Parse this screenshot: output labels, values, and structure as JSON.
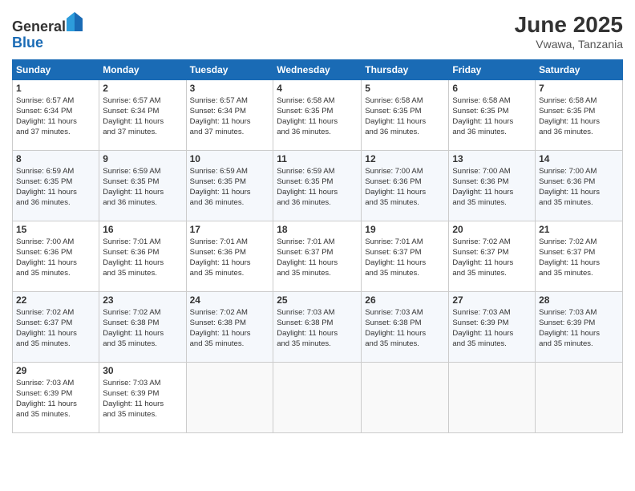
{
  "header": {
    "logo_general": "General",
    "logo_blue": "Blue",
    "month": "June 2025",
    "location": "Vwawa, Tanzania"
  },
  "days_of_week": [
    "Sunday",
    "Monday",
    "Tuesday",
    "Wednesday",
    "Thursday",
    "Friday",
    "Saturday"
  ],
  "weeks": [
    [
      {
        "day": "1",
        "info": "Sunrise: 6:57 AM\nSunset: 6:34 PM\nDaylight: 11 hours\nand 37 minutes."
      },
      {
        "day": "2",
        "info": "Sunrise: 6:57 AM\nSunset: 6:34 PM\nDaylight: 11 hours\nand 37 minutes."
      },
      {
        "day": "3",
        "info": "Sunrise: 6:57 AM\nSunset: 6:34 PM\nDaylight: 11 hours\nand 37 minutes."
      },
      {
        "day": "4",
        "info": "Sunrise: 6:58 AM\nSunset: 6:35 PM\nDaylight: 11 hours\nand 36 minutes."
      },
      {
        "day": "5",
        "info": "Sunrise: 6:58 AM\nSunset: 6:35 PM\nDaylight: 11 hours\nand 36 minutes."
      },
      {
        "day": "6",
        "info": "Sunrise: 6:58 AM\nSunset: 6:35 PM\nDaylight: 11 hours\nand 36 minutes."
      },
      {
        "day": "7",
        "info": "Sunrise: 6:58 AM\nSunset: 6:35 PM\nDaylight: 11 hours\nand 36 minutes."
      }
    ],
    [
      {
        "day": "8",
        "info": "Sunrise: 6:59 AM\nSunset: 6:35 PM\nDaylight: 11 hours\nand 36 minutes."
      },
      {
        "day": "9",
        "info": "Sunrise: 6:59 AM\nSunset: 6:35 PM\nDaylight: 11 hours\nand 36 minutes."
      },
      {
        "day": "10",
        "info": "Sunrise: 6:59 AM\nSunset: 6:35 PM\nDaylight: 11 hours\nand 36 minutes."
      },
      {
        "day": "11",
        "info": "Sunrise: 6:59 AM\nSunset: 6:35 PM\nDaylight: 11 hours\nand 36 minutes."
      },
      {
        "day": "12",
        "info": "Sunrise: 7:00 AM\nSunset: 6:36 PM\nDaylight: 11 hours\nand 35 minutes."
      },
      {
        "day": "13",
        "info": "Sunrise: 7:00 AM\nSunset: 6:36 PM\nDaylight: 11 hours\nand 35 minutes."
      },
      {
        "day": "14",
        "info": "Sunrise: 7:00 AM\nSunset: 6:36 PM\nDaylight: 11 hours\nand 35 minutes."
      }
    ],
    [
      {
        "day": "15",
        "info": "Sunrise: 7:00 AM\nSunset: 6:36 PM\nDaylight: 11 hours\nand 35 minutes."
      },
      {
        "day": "16",
        "info": "Sunrise: 7:01 AM\nSunset: 6:36 PM\nDaylight: 11 hours\nand 35 minutes."
      },
      {
        "day": "17",
        "info": "Sunrise: 7:01 AM\nSunset: 6:36 PM\nDaylight: 11 hours\nand 35 minutes."
      },
      {
        "day": "18",
        "info": "Sunrise: 7:01 AM\nSunset: 6:37 PM\nDaylight: 11 hours\nand 35 minutes."
      },
      {
        "day": "19",
        "info": "Sunrise: 7:01 AM\nSunset: 6:37 PM\nDaylight: 11 hours\nand 35 minutes."
      },
      {
        "day": "20",
        "info": "Sunrise: 7:02 AM\nSunset: 6:37 PM\nDaylight: 11 hours\nand 35 minutes."
      },
      {
        "day": "21",
        "info": "Sunrise: 7:02 AM\nSunset: 6:37 PM\nDaylight: 11 hours\nand 35 minutes."
      }
    ],
    [
      {
        "day": "22",
        "info": "Sunrise: 7:02 AM\nSunset: 6:37 PM\nDaylight: 11 hours\nand 35 minutes."
      },
      {
        "day": "23",
        "info": "Sunrise: 7:02 AM\nSunset: 6:38 PM\nDaylight: 11 hours\nand 35 minutes."
      },
      {
        "day": "24",
        "info": "Sunrise: 7:02 AM\nSunset: 6:38 PM\nDaylight: 11 hours\nand 35 minutes."
      },
      {
        "day": "25",
        "info": "Sunrise: 7:03 AM\nSunset: 6:38 PM\nDaylight: 11 hours\nand 35 minutes."
      },
      {
        "day": "26",
        "info": "Sunrise: 7:03 AM\nSunset: 6:38 PM\nDaylight: 11 hours\nand 35 minutes."
      },
      {
        "day": "27",
        "info": "Sunrise: 7:03 AM\nSunset: 6:39 PM\nDaylight: 11 hours\nand 35 minutes."
      },
      {
        "day": "28",
        "info": "Sunrise: 7:03 AM\nSunset: 6:39 PM\nDaylight: 11 hours\nand 35 minutes."
      }
    ],
    [
      {
        "day": "29",
        "info": "Sunrise: 7:03 AM\nSunset: 6:39 PM\nDaylight: 11 hours\nand 35 minutes."
      },
      {
        "day": "30",
        "info": "Sunrise: 7:03 AM\nSunset: 6:39 PM\nDaylight: 11 hours\nand 35 minutes."
      },
      {
        "day": "",
        "info": ""
      },
      {
        "day": "",
        "info": ""
      },
      {
        "day": "",
        "info": ""
      },
      {
        "day": "",
        "info": ""
      },
      {
        "day": "",
        "info": ""
      }
    ]
  ]
}
